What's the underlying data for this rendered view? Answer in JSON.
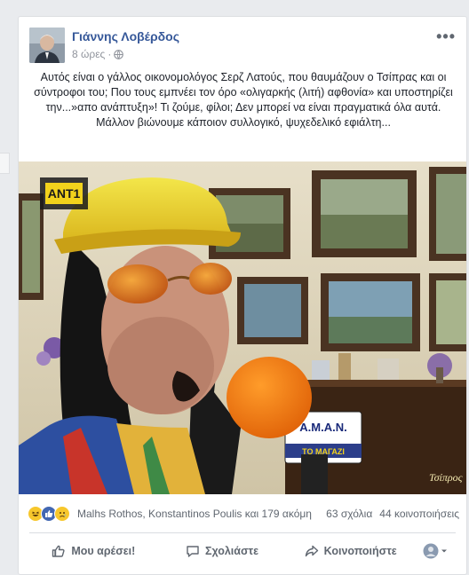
{
  "post": {
    "author": "Γιάννης Λοβέρδος",
    "time": "8 ώρες",
    "privacy_icon": "globe-icon",
    "text": "Αυτός είναι ο γάλλος οικονομολόγος Σερζ Λατούς, που θαυμάζουν ο Τσίπρας και οι σύντροφοι του; Που τους εμπνέει τον όρο «ολιγαρκής (λιτή) αφθονία» και υποστηρίζει την...»απο ανάπτυξη»! Τι ζούμε, φίλοι; Δεν μπορεί να είναι πραγματικά όλα αυτά. Μάλλον βιώνουμε κάποιον συλλογικό, ψυχεδελικό εφιάλτη...",
    "more_icon": "more-options-icon"
  },
  "photo": {
    "microphone_label_line1": "A.M.A.N.",
    "microphone_label_line2": "ΤΟ ΜΑΓΑΖΙ",
    "watermark": "Τσίπρος"
  },
  "reactions": {
    "names": "Malhs Rothos, Konstantinos Poulis και 179 ακόμη",
    "comments": "63 σχόλια",
    "shares": "44 κοινοποιήσεις",
    "icons": [
      "haha-icon",
      "like-icon",
      "sad-icon"
    ]
  },
  "actions": {
    "like": "Μου αρέσει!",
    "comment": "Σχολιάστε",
    "share": "Κοινοποιήστε"
  },
  "colors": {
    "link": "#365899",
    "secondary_text": "#606770",
    "like_blue": "#4267b2",
    "reaction_yellow": "#f7c72c"
  }
}
